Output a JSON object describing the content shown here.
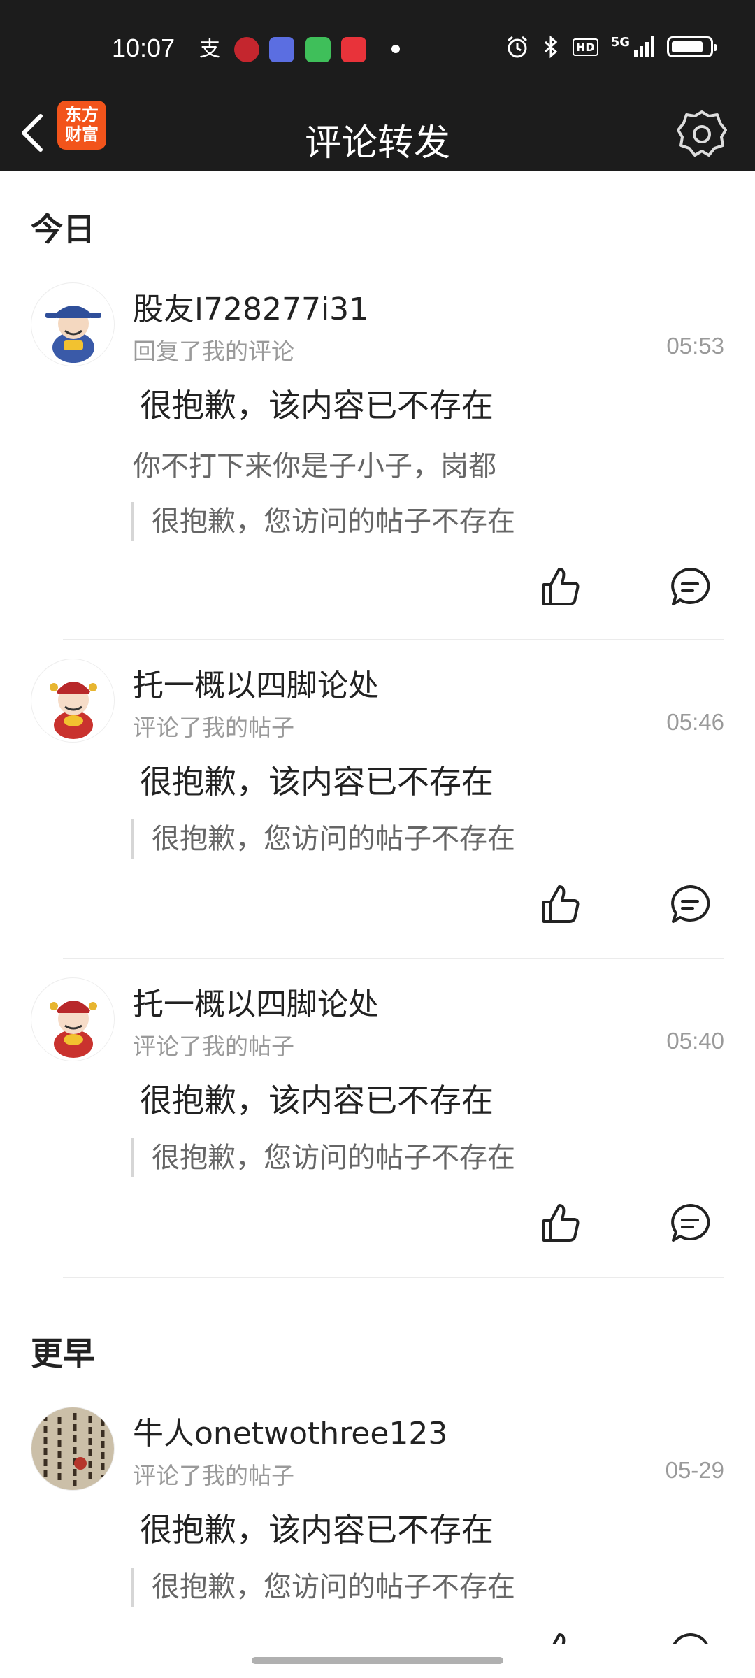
{
  "status_bar": {
    "time": "10:07",
    "network": "5G",
    "hd": "HD",
    "battery_level": 0.85
  },
  "header": {
    "back_icon": "chevron-left-icon",
    "logo_text_top": "东方",
    "logo_text_bottom": "财富",
    "title": "评论转发",
    "settings_icon": "gear-icon"
  },
  "sections": {
    "today": "今日",
    "earlier": "更早"
  },
  "items": [
    {
      "username": "股友I728277i31",
      "action": "回复了我的评论",
      "time": "05:53",
      "main_text": "很抱歉，该内容已不存在",
      "reply_text": "你不打下来你是子小子，岗都",
      "quote": "很抱歉，您访问的帖子不存在"
    },
    {
      "username": "托一概以四脚论处",
      "action": "评论了我的帖子",
      "time": "05:46",
      "main_text": "很抱歉，该内容已不存在",
      "quote": "很抱歉，您访问的帖子不存在"
    },
    {
      "username": "托一概以四脚论处",
      "action": "评论了我的帖子",
      "time": "05:40",
      "main_text": "很抱歉，该内容已不存在",
      "quote": "很抱歉，您访问的帖子不存在"
    },
    {
      "username": "牛人onetwothree123",
      "action": "评论了我的帖子",
      "time": "05-29",
      "main_text": "很抱歉，该内容已不存在",
      "quote": "很抱歉，您访问的帖子不存在"
    }
  ],
  "colors": {
    "header_bg": "#1c1c1c",
    "logo_orange": "#f2541b",
    "secondary_text": "#9a9a9a"
  }
}
